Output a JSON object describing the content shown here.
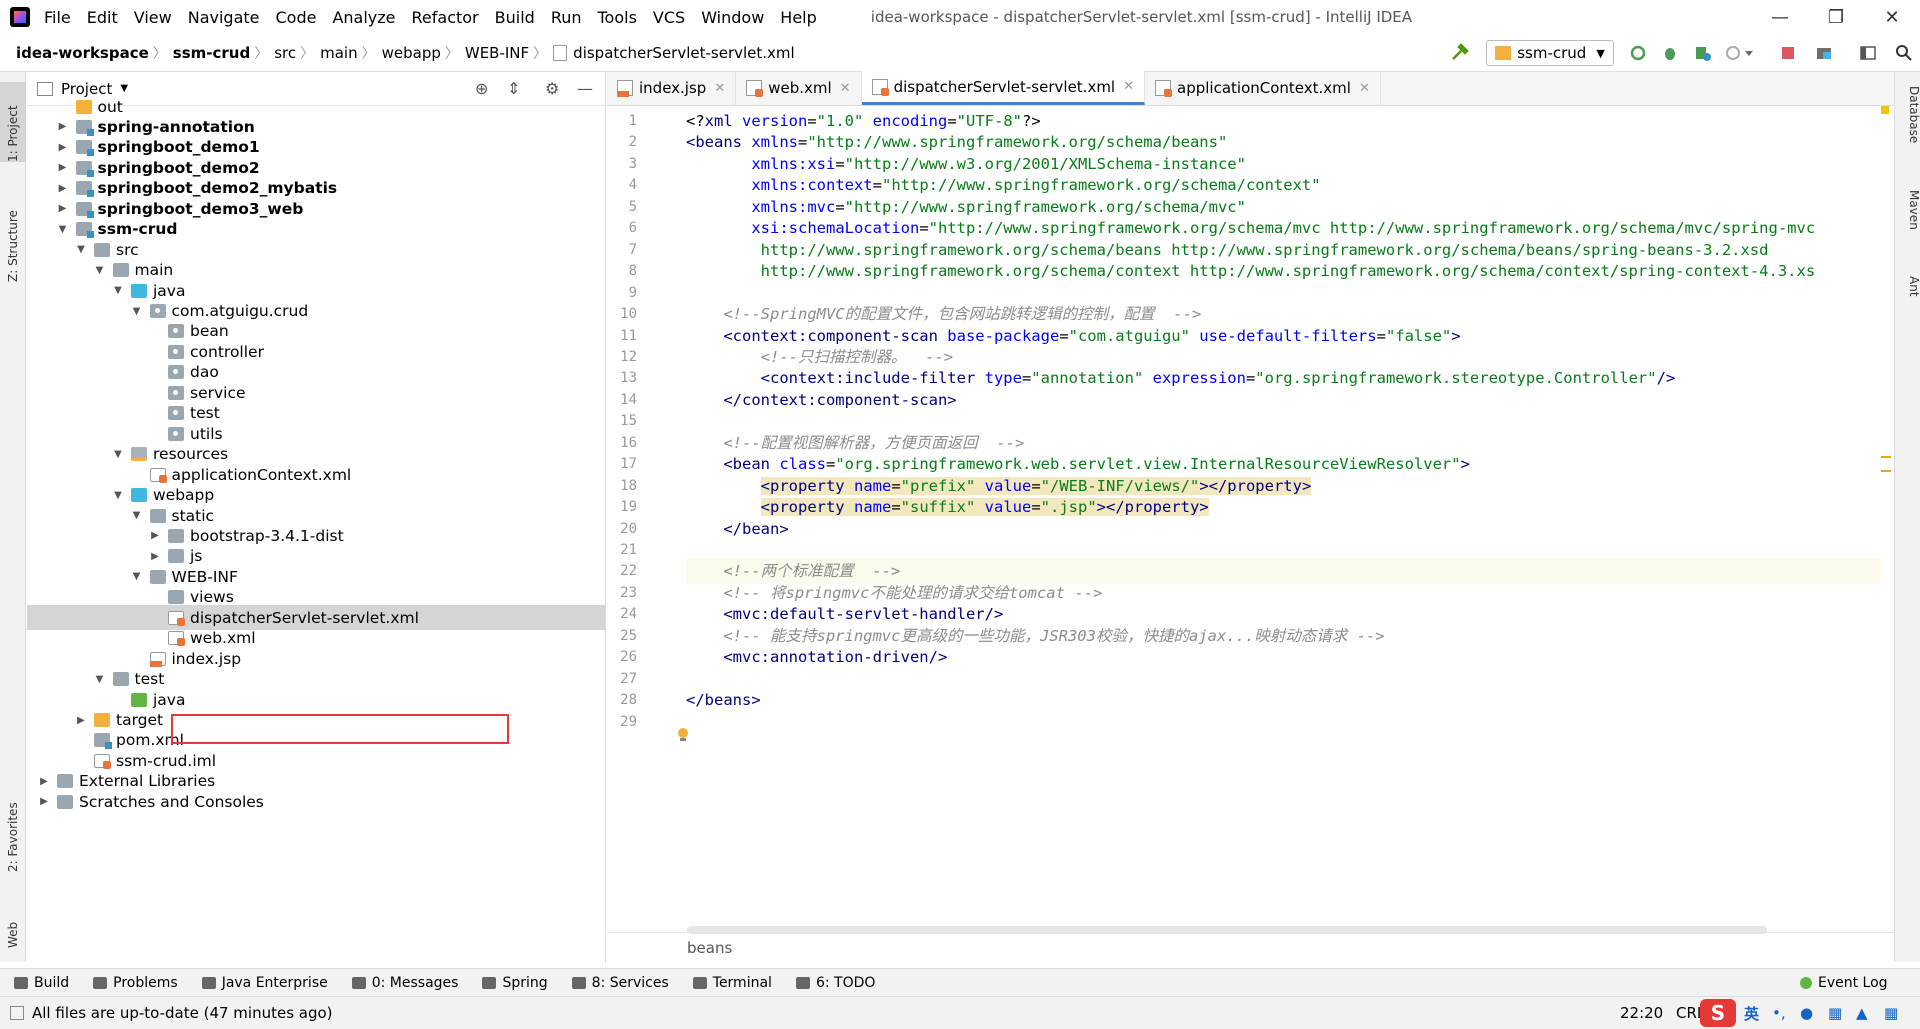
{
  "window": {
    "title": "idea-workspace - dispatcherServlet-servlet.xml [ssm-crud] - IntelliJ IDEA",
    "menu": [
      "File",
      "Edit",
      "View",
      "Navigate",
      "Code",
      "Analyze",
      "Refactor",
      "Build",
      "Run",
      "Tools",
      "VCS",
      "Window",
      "Help"
    ]
  },
  "nav": {
    "breadcrumbs": [
      "idea-workspace",
      "ssm-crud",
      "src",
      "main",
      "webapp",
      "WEB-INF",
      "dispatcherServlet-servlet.xml"
    ],
    "run_config": "ssm-crud"
  },
  "left_strip": {
    "project": "1: Project",
    "structure": "Z: Structure",
    "favorites": "2: Favorites",
    "web": "Web"
  },
  "right_strip": {
    "database": "Database",
    "maven": "Maven",
    "ant": "Ant"
  },
  "project": {
    "header": "Project",
    "tree": [
      {
        "label": "out",
        "depth": 1,
        "arrow": "",
        "icon": "f-orange",
        "bold": false
      },
      {
        "label": "spring-annotation",
        "depth": 1,
        "arrow": "▶",
        "icon": "f-mod",
        "bold": true
      },
      {
        "label": "springboot_demo1",
        "depth": 1,
        "arrow": "▶",
        "icon": "f-mod",
        "bold": true
      },
      {
        "label": "springboot_demo2",
        "depth": 1,
        "arrow": "▶",
        "icon": "f-mod",
        "bold": true
      },
      {
        "label": "springboot_demo2_mybatis",
        "depth": 1,
        "arrow": "▶",
        "icon": "f-mod",
        "bold": true
      },
      {
        "label": "springboot_demo3_web",
        "depth": 1,
        "arrow": "▶",
        "icon": "f-mod",
        "bold": true
      },
      {
        "label": "ssm-crud",
        "depth": 1,
        "arrow": "▼",
        "icon": "f-mod",
        "bold": true
      },
      {
        "label": "src",
        "depth": 2,
        "arrow": "▼",
        "icon": "f-gray",
        "bold": false
      },
      {
        "label": "main",
        "depth": 3,
        "arrow": "▼",
        "icon": "f-gray",
        "bold": false
      },
      {
        "label": "java",
        "depth": 4,
        "arrow": "▼",
        "icon": "f-blue",
        "bold": false
      },
      {
        "label": "com.atguigu.crud",
        "depth": 5,
        "arrow": "▼",
        "icon": "f-pkg",
        "bold": false
      },
      {
        "label": "bean",
        "depth": 6,
        "arrow": "",
        "icon": "f-pkg",
        "bold": false
      },
      {
        "label": "controller",
        "depth": 6,
        "arrow": "",
        "icon": "f-pkg",
        "bold": false
      },
      {
        "label": "dao",
        "depth": 6,
        "arrow": "",
        "icon": "f-pkg",
        "bold": false
      },
      {
        "label": "service",
        "depth": 6,
        "arrow": "",
        "icon": "f-pkg",
        "bold": false
      },
      {
        "label": "test",
        "depth": 6,
        "arrow": "",
        "icon": "f-pkg",
        "bold": false
      },
      {
        "label": "utils",
        "depth": 6,
        "arrow": "",
        "icon": "f-pkg",
        "bold": false
      },
      {
        "label": "resources",
        "depth": 4,
        "arrow": "▼",
        "icon": "f-res",
        "bold": false
      },
      {
        "label": "applicationContext.xml",
        "depth": 5,
        "arrow": "",
        "icon": "f-xml",
        "bold": false
      },
      {
        "label": "webapp",
        "depth": 4,
        "arrow": "▼",
        "icon": "f-blue",
        "bold": false
      },
      {
        "label": "static",
        "depth": 5,
        "arrow": "▼",
        "icon": "f-gray",
        "bold": false
      },
      {
        "label": "bootstrap-3.4.1-dist",
        "depth": 6,
        "arrow": "▶",
        "icon": "f-gray",
        "bold": false
      },
      {
        "label": "js",
        "depth": 6,
        "arrow": "▶",
        "icon": "f-gray",
        "bold": false
      },
      {
        "label": "WEB-INF",
        "depth": 5,
        "arrow": "▼",
        "icon": "f-gray",
        "bold": false
      },
      {
        "label": "views",
        "depth": 6,
        "arrow": "",
        "icon": "f-gray",
        "bold": false
      },
      {
        "label": "dispatcherServlet-servlet.xml",
        "depth": 6,
        "arrow": "",
        "icon": "f-xml",
        "bold": false,
        "selected": true
      },
      {
        "label": "web.xml",
        "depth": 6,
        "arrow": "",
        "icon": "f-xml",
        "bold": false
      },
      {
        "label": "index.jsp",
        "depth": 5,
        "arrow": "",
        "icon": "f-jsp",
        "bold": false
      },
      {
        "label": "test",
        "depth": 3,
        "arrow": "▼",
        "icon": "f-gray",
        "bold": false
      },
      {
        "label": "java",
        "depth": 4,
        "arrow": "",
        "icon": "f-green",
        "bold": false
      },
      {
        "label": "target",
        "depth": 2,
        "arrow": "▶",
        "icon": "f-orange",
        "bold": false
      },
      {
        "label": "pom.xml",
        "depth": 2,
        "arrow": "",
        "icon": "f-mod",
        "bold": false
      },
      {
        "label": "ssm-crud.iml",
        "depth": 2,
        "arrow": "",
        "icon": "f-xml",
        "bold": false
      },
      {
        "label": "External Libraries",
        "depth": 0,
        "arrow": "▶",
        "icon": "f-gray",
        "bold": false
      },
      {
        "label": "Scratches and Consoles",
        "depth": 0,
        "arrow": "▶",
        "icon": "f-gray",
        "bold": false
      }
    ]
  },
  "editor": {
    "tabs": [
      {
        "label": "index.jsp",
        "icon": "jsp",
        "active": false
      },
      {
        "label": "web.xml",
        "icon": "xml",
        "active": false
      },
      {
        "label": "dispatcherServlet-servlet.xml",
        "icon": "xml",
        "active": true
      },
      {
        "label": "applicationContext.xml",
        "icon": "xml",
        "active": false
      }
    ],
    "line_numbers": [
      "1",
      "2",
      "3",
      "4",
      "5",
      "6",
      "7",
      "8",
      "9",
      "10",
      "11",
      "12",
      "13",
      "14",
      "15",
      "16",
      "17",
      "18",
      "19",
      "20",
      "21",
      "22",
      "23",
      "24",
      "25",
      "26",
      "27",
      "28",
      "29"
    ],
    "current_line": "22",
    "lines": [
      [
        [
          "t-def",
          "<?"
        ],
        [
          "t-tag",
          "xml "
        ],
        [
          "t-attr",
          "version"
        ],
        [
          "t-def",
          "="
        ],
        [
          "t-val",
          "\"1.0\" "
        ],
        [
          "t-attr",
          "encoding"
        ],
        [
          "t-def",
          "="
        ],
        [
          "t-val",
          "\"UTF-8\""
        ],
        [
          "t-def",
          "?>"
        ]
      ],
      [
        [
          "t-tag",
          "<beans "
        ],
        [
          "t-attr",
          "xmlns"
        ],
        [
          "t-def",
          "="
        ],
        [
          "t-val",
          "\"http://www.springframework.org/schema/beans\""
        ]
      ],
      [
        [
          "t-def",
          "       "
        ],
        [
          "t-attr",
          "xmlns:xsi"
        ],
        [
          "t-def",
          "="
        ],
        [
          "t-val",
          "\"http://www.w3.org/2001/XMLSchema-instance\""
        ]
      ],
      [
        [
          "t-def",
          "       "
        ],
        [
          "t-attr",
          "xmlns:context"
        ],
        [
          "t-def",
          "="
        ],
        [
          "t-val",
          "\"http://www.springframework.org/schema/context\""
        ]
      ],
      [
        [
          "t-def",
          "       "
        ],
        [
          "t-attr",
          "xmlns:mvc"
        ],
        [
          "t-def",
          "="
        ],
        [
          "t-val",
          "\"http://www.springframework.org/schema/mvc\""
        ]
      ],
      [
        [
          "t-def",
          "       "
        ],
        [
          "t-attr",
          "xsi:schemaLocation"
        ],
        [
          "t-def",
          "="
        ],
        [
          "t-val",
          "\"http://www.springframework.org/schema/mvc http://www.springframework.org/schema/mvc/spring-mvc"
        ]
      ],
      [
        [
          "t-val",
          "        http://www.springframework.org/schema/beans http://www.springframework.org/schema/beans/spring-beans-3.2.xsd"
        ]
      ],
      [
        [
          "t-val",
          "        http://www.springframework.org/schema/context http://www.springframework.org/schema/context/spring-context-4.3.xs"
        ]
      ],
      [],
      [
        [
          "t-com",
          "    <!--SpringMVC的配置文件，包含网站跳转逻辑的控制，配置  -->"
        ]
      ],
      [
        [
          "t-def",
          "    "
        ],
        [
          "t-tag",
          "<context:component-scan "
        ],
        [
          "t-attr",
          "base-package"
        ],
        [
          "t-def",
          "="
        ],
        [
          "t-val",
          "\"com.atguigu\" "
        ],
        [
          "t-attr",
          "use-default-filters"
        ],
        [
          "t-def",
          "="
        ],
        [
          "t-val",
          "\"false\""
        ],
        [
          "t-tag",
          ">"
        ]
      ],
      [
        [
          "t-com",
          "        <!--只扫描控制器。  -->"
        ]
      ],
      [
        [
          "t-def",
          "        "
        ],
        [
          "t-tag",
          "<context:include-filter "
        ],
        [
          "t-attr",
          "type"
        ],
        [
          "t-def",
          "="
        ],
        [
          "t-val",
          "\"annotation\" "
        ],
        [
          "t-attr",
          "expression"
        ],
        [
          "t-def",
          "="
        ],
        [
          "t-val",
          "\"org.springframework.stereotype.Controller\""
        ],
        [
          "t-tag",
          "/>"
        ]
      ],
      [
        [
          "t-def",
          "    "
        ],
        [
          "t-tag",
          "</context:component-scan>"
        ]
      ],
      [],
      [
        [
          "t-com",
          "    <!--配置视图解析器，方便页面返回  -->"
        ]
      ],
      [
        [
          "t-def",
          "    "
        ],
        [
          "t-tag",
          "<bean "
        ],
        [
          "t-attr",
          "class"
        ],
        [
          "t-def",
          "="
        ],
        [
          "t-val",
          "\"org.springframework.web.servlet.view.InternalResourceViewResolver\""
        ],
        [
          "t-tag",
          ">"
        ]
      ],
      [
        [
          "t-def",
          "        "
        ],
        [
          "t-tag hl",
          "<property "
        ],
        [
          "t-attr hl",
          "name"
        ],
        [
          "t-def hl",
          "="
        ],
        [
          "t-val hl",
          "\"prefix\" "
        ],
        [
          "t-attr hl",
          "value"
        ],
        [
          "t-def hl",
          "="
        ],
        [
          "t-val hl",
          "\"/WEB-INF/views/\""
        ],
        [
          "t-tag hl",
          "></property>"
        ]
      ],
      [
        [
          "t-def",
          "        "
        ],
        [
          "t-tag hl",
          "<property "
        ],
        [
          "t-attr hl",
          "name"
        ],
        [
          "t-def hl",
          "="
        ],
        [
          "t-val hl",
          "\"suffix\" "
        ],
        [
          "t-attr hl",
          "value"
        ],
        [
          "t-def hl",
          "="
        ],
        [
          "t-val hl",
          "\".jsp\""
        ],
        [
          "t-tag hl",
          "></property>"
        ]
      ],
      [
        [
          "t-def",
          "    "
        ],
        [
          "t-tag",
          "</bean>"
        ]
      ],
      [],
      [
        [
          "t-com",
          "    <!--两个标准配置  -->"
        ]
      ],
      [
        [
          "t-com",
          "    <!-- 将springmvc不能处理的请求交给tomcat -->"
        ]
      ],
      [
        [
          "t-def",
          "    "
        ],
        [
          "t-tag",
          "<mvc:default-servlet-handler/>"
        ]
      ],
      [
        [
          "t-com",
          "    <!-- 能支持springmvc更高级的一些功能，JSR303校验，快捷的ajax...映射动态请求 -->"
        ]
      ],
      [
        [
          "t-def",
          "    "
        ],
        [
          "t-tag",
          "<mvc:annotation-driven/>"
        ]
      ],
      [],
      [
        [
          "t-tag",
          "</beans>"
        ]
      ],
      []
    ],
    "crumb": "beans"
  },
  "toolwindows": [
    {
      "label": "Build",
      "icon": "hammer-icon"
    },
    {
      "label": "Problems",
      "icon": "warning-icon"
    },
    {
      "label": "Java Enterprise",
      "icon": "java-ee-icon"
    },
    {
      "label": "0: Messages",
      "icon": "messages-icon"
    },
    {
      "label": "Spring",
      "icon": "spring-icon"
    },
    {
      "label": "8: Services",
      "icon": "services-icon"
    },
    {
      "label": "Terminal",
      "icon": "terminal-icon"
    },
    {
      "label": "6: TODO",
      "icon": "todo-icon"
    }
  ],
  "event_log": "Event Log",
  "status": {
    "message": "All files are up-to-date (47 minutes ago)",
    "position": "22:20",
    "line_sep": "CRL",
    "ime": "英"
  },
  "colors": {
    "accent": "#4083c9",
    "selection_box": "#e53935"
  }
}
